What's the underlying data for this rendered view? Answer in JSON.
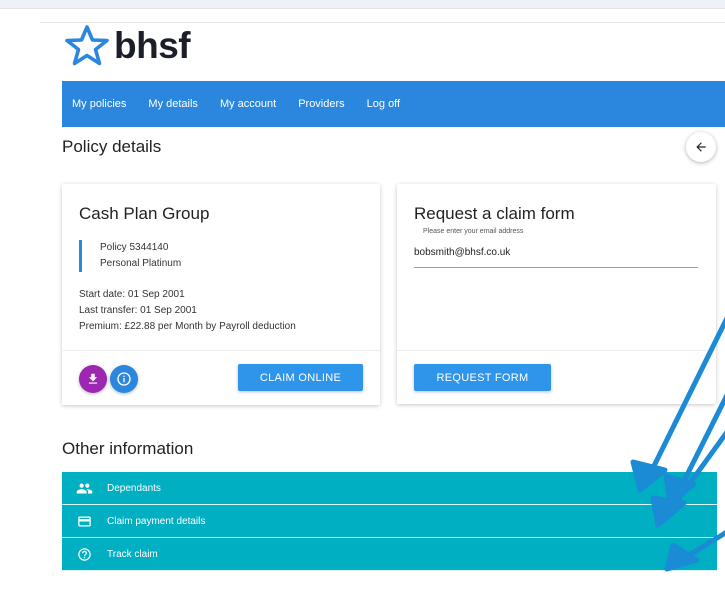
{
  "brand": {
    "name": "bhsf",
    "star_color": "#2b86de"
  },
  "nav": {
    "items": [
      {
        "label": "My policies"
      },
      {
        "label": "My details"
      },
      {
        "label": "My account"
      },
      {
        "label": "Providers"
      },
      {
        "label": "Log off"
      }
    ],
    "background": "#2b86de"
  },
  "page": {
    "title": "Policy details",
    "back_icon": "arrow-left-icon"
  },
  "policy_card": {
    "title": "Cash Plan Group",
    "policy_number": "Policy 5344140",
    "plan": "Personal Platinum",
    "start_date": "Start date: 01 Sep 2001",
    "last_transfer": "Last transfer: 01 Sep 2001",
    "premium": "Premium: £22.88 per Month by Payroll deduction",
    "download_icon": "download-icon",
    "info_icon": "info-icon",
    "claim_button": "CLAIM ONLINE"
  },
  "claim_form_card": {
    "title": "Request a claim form",
    "email_label": "Please enter your email address",
    "email_value": "bobsmith@bhsf.co.uk",
    "request_button": "REQUEST FORM"
  },
  "other_info": {
    "title": "Other information",
    "items": [
      {
        "label": "Dependants",
        "icon": "people-icon"
      },
      {
        "label": "Claim payment details",
        "icon": "credit-card-icon"
      },
      {
        "label": "Track claim",
        "icon": "help-circle-icon"
      }
    ],
    "background": "#00afc1"
  },
  "annotation": {
    "arrow_color": "#1b8bd6"
  }
}
